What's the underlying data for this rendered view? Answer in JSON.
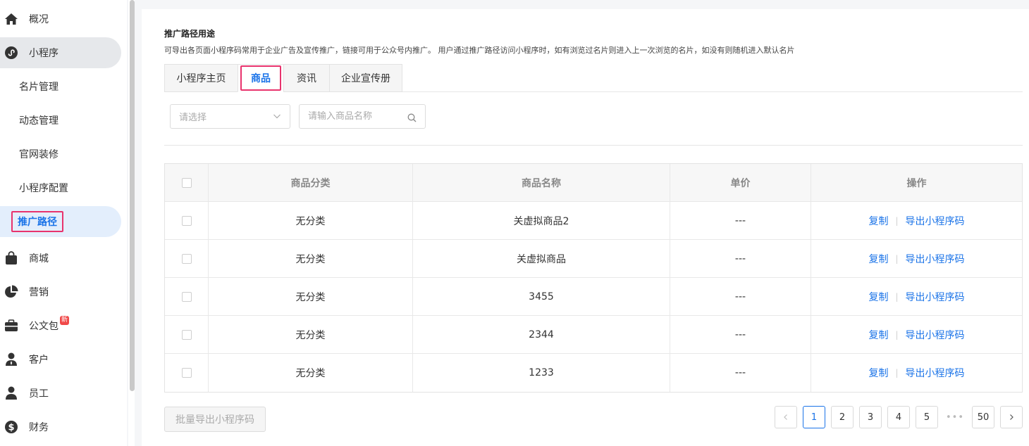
{
  "sidebar": {
    "items": [
      {
        "label": "概况",
        "icon": "home-icon"
      },
      {
        "label": "小程序",
        "icon": "miniprogram-icon"
      },
      {
        "label": "商城",
        "icon": "shopping-bag-icon"
      },
      {
        "label": "营销",
        "icon": "pie-chart-icon"
      },
      {
        "label": "公文包",
        "icon": "briefcase-icon",
        "badge": "新"
      },
      {
        "label": "客户",
        "icon": "customer-icon"
      },
      {
        "label": "员工",
        "icon": "person-icon"
      },
      {
        "label": "财务",
        "icon": "dollar-icon"
      }
    ],
    "subitems": [
      {
        "label": "名片管理"
      },
      {
        "label": "动态管理"
      },
      {
        "label": "官网装修"
      },
      {
        "label": "小程序配置"
      },
      {
        "label": "推广路径",
        "active": true
      }
    ]
  },
  "main": {
    "title": "推广路径用途",
    "description": "可导出各页面小程序码常用于企业广告及宣传推广，链接可用于公众号内推广。 用户通过推广路径访问小程序时，如有浏览过名片则进入上一次浏览的名片，如没有则随机进入默认名片",
    "tabs": [
      {
        "label": "小程序主页"
      },
      {
        "label": "商品",
        "active": true
      },
      {
        "label": "资讯"
      },
      {
        "label": "企业宣传册"
      }
    ],
    "filters": {
      "select_placeholder": "请选择",
      "search_placeholder": "请输入商品名称"
    },
    "table": {
      "headers": [
        "商品分类",
        "商品名称",
        "单价",
        "操作"
      ],
      "rows": [
        {
          "category": "无分类",
          "name": "关虚拟商品2",
          "price": "---"
        },
        {
          "category": "无分类",
          "name": "关虚拟商品",
          "price": "---"
        },
        {
          "category": "无分类",
          "name": "3455",
          "price": "---"
        },
        {
          "category": "无分类",
          "name": "2344",
          "price": "---"
        },
        {
          "category": "无分类",
          "name": "1233",
          "price": "---"
        }
      ],
      "action_copy": "复制",
      "action_export": "导出小程序码"
    },
    "batch_export_label": "批量导出小程序码",
    "pagination": {
      "pages": [
        "1",
        "2",
        "3",
        "4",
        "5"
      ],
      "ellipsis": "•••",
      "last": "50",
      "current": "1"
    }
  },
  "colors": {
    "accent": "#1a73e8",
    "highlight_border": "#e8336d"
  }
}
